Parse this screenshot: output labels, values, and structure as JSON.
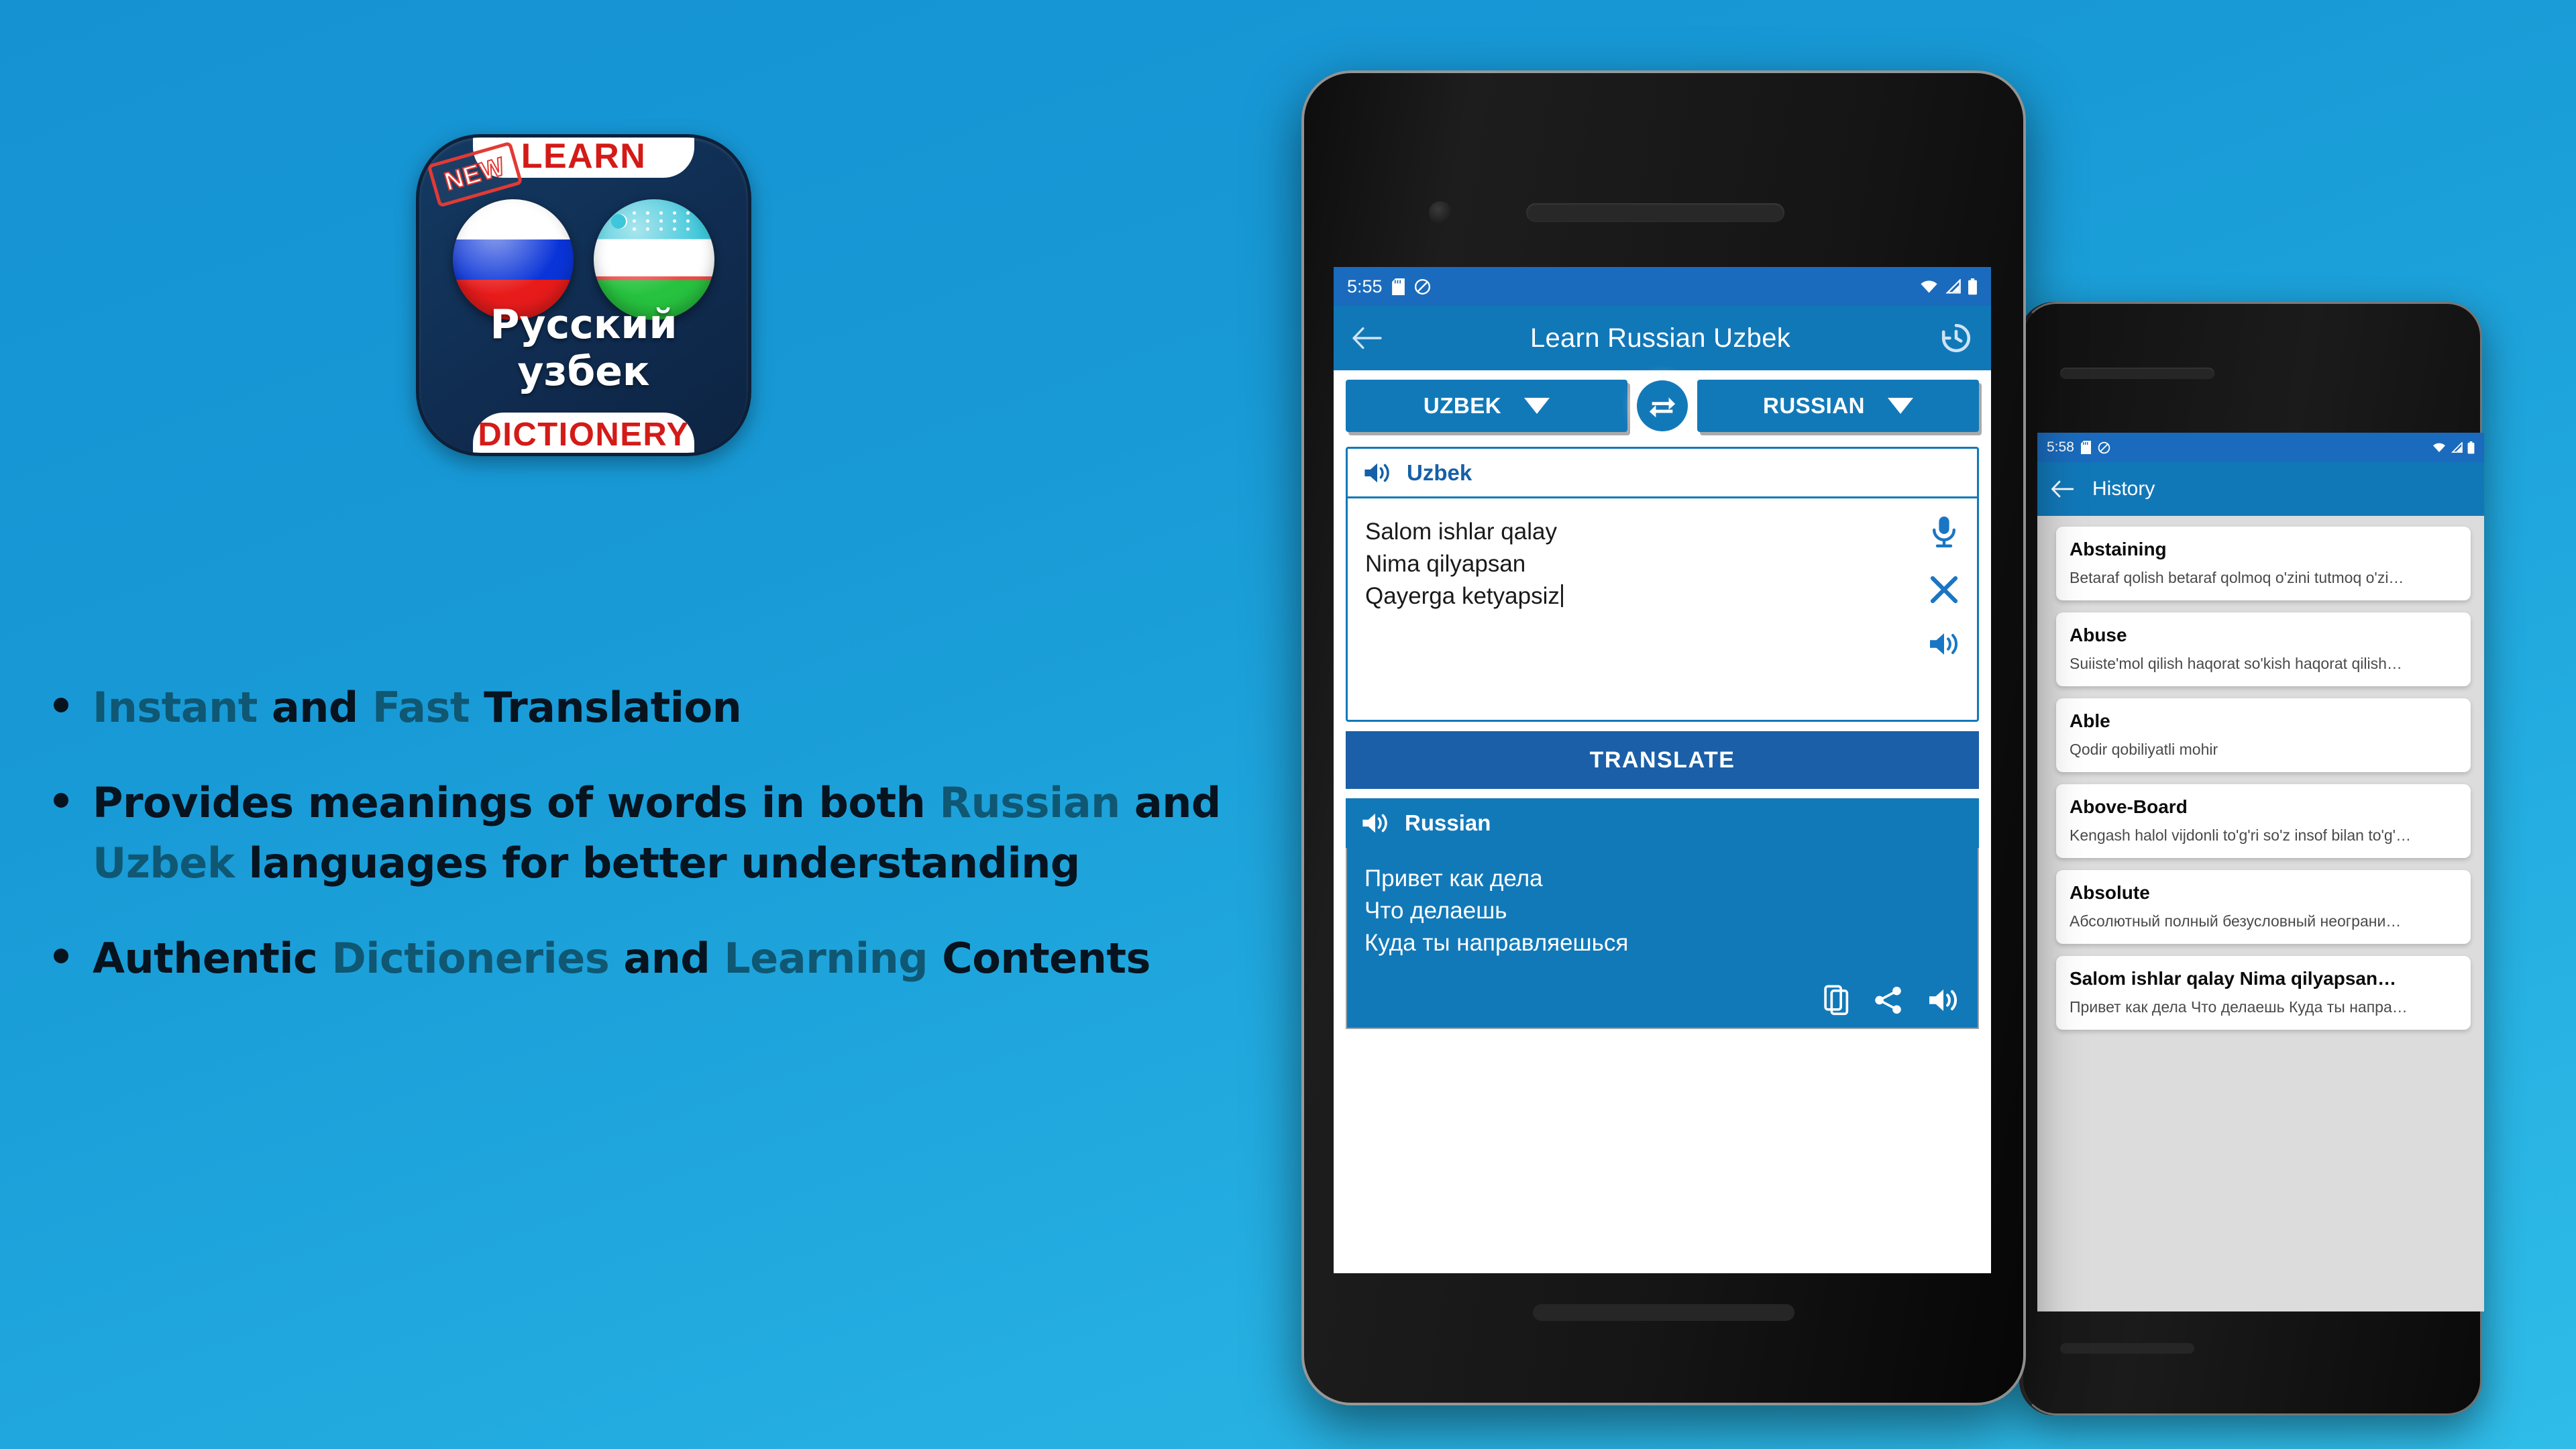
{
  "app_icon": {
    "top_ribbon": "LEARN",
    "bottom_ribbon": "DICTIONERY",
    "badge": "NEW",
    "title": "Русский узбек",
    "flag_left": "russia-flag",
    "flag_right": "uzbekistan-flag"
  },
  "features": [
    {
      "parts": [
        {
          "text": "Instant",
          "highlight": true
        },
        {
          "text": " and ",
          "highlight": false
        },
        {
          "text": "Fast",
          "highlight": true
        },
        {
          "text": " Translation",
          "highlight": false
        }
      ]
    },
    {
      "parts": [
        {
          "text": "Provides meanings of words in both ",
          "highlight": false
        },
        {
          "text": "Russian",
          "highlight": true
        },
        {
          "text": " and ",
          "highlight": false
        },
        {
          "text": "Uzbek",
          "highlight": true
        },
        {
          "text": " languages for better understanding",
          "highlight": false
        }
      ]
    },
    {
      "parts": [
        {
          "text": "Authentic ",
          "highlight": false
        },
        {
          "text": "Dictioneries",
          "highlight": true
        },
        {
          "text": " and ",
          "highlight": false
        },
        {
          "text": "Learning",
          "highlight": true
        },
        {
          "text": " Contents",
          "highlight": false
        }
      ]
    }
  ],
  "phone_main": {
    "status": {
      "time": "5:55",
      "icons": [
        "sd-card-icon",
        "do-not-disturb-icon",
        "wifi-icon",
        "signal-icon",
        "battery-icon"
      ]
    },
    "appbar": {
      "back": "back-arrow-icon",
      "title": "Learn Russian Uzbek",
      "history": "history-icon"
    },
    "lang_from": "UZBEK",
    "lang_to": "RUSSIAN",
    "swap": "swap-horizontal-icon",
    "source": {
      "label": "Uzbek",
      "speaker": "speaker-icon",
      "text": "Salom ishlar qalay\nNima qilyapsan\nQayerga ketyapsiz",
      "icons": [
        "microphone-icon",
        "clear-icon",
        "speaker-icon"
      ]
    },
    "translate_label": "TRANSLATE",
    "target": {
      "label": "Russian",
      "speaker": "speaker-icon",
      "text": "Привет как дела\nЧто делаешь\nКуда ты направляешься",
      "icons": [
        "copy-icon",
        "share-icon",
        "speaker-icon"
      ]
    }
  },
  "phone_history": {
    "status": {
      "time": "5:58",
      "icons": [
        "sd-card-icon",
        "do-not-disturb-icon",
        "wifi-icon",
        "signal-icon",
        "battery-icon"
      ]
    },
    "appbar": {
      "back": "back-arrow-icon",
      "title": "History"
    },
    "items": [
      {
        "title": "Abstaining",
        "subtitle": "Betaraf qolish  betaraf qolmoq o'zini tutmoq o'zi…"
      },
      {
        "title": "Abuse",
        "subtitle": "Suiiste'mol qilish  haqorat so'kish haqorat qilish…"
      },
      {
        "title": "Able",
        "subtitle": "Qodir  qobiliyatli mohir"
      },
      {
        "title": "Above-Board",
        "subtitle": "Kengash  halol vijdonli to'g'ri so'z insof bilan to'g'…"
      },
      {
        "title": "Absolute",
        "subtitle": "Абсолютный  полный безусловный неограни…"
      },
      {
        "title": "Salom ishlar qalay Nima qilyapsan…",
        "subtitle": "Привет как дела Что делаешь Куда ты напра…"
      }
    ]
  },
  "colors": {
    "background_top": "#1592d2",
    "background_bottom": "#2fbce8",
    "primary_blue": "#1279b9",
    "dark_blue": "#1a5fa8",
    "status_blue": "#1a6bbd",
    "icon_navy": "#102c50",
    "accent_red": "#d31b18",
    "highlight_text": "#0f5773"
  }
}
